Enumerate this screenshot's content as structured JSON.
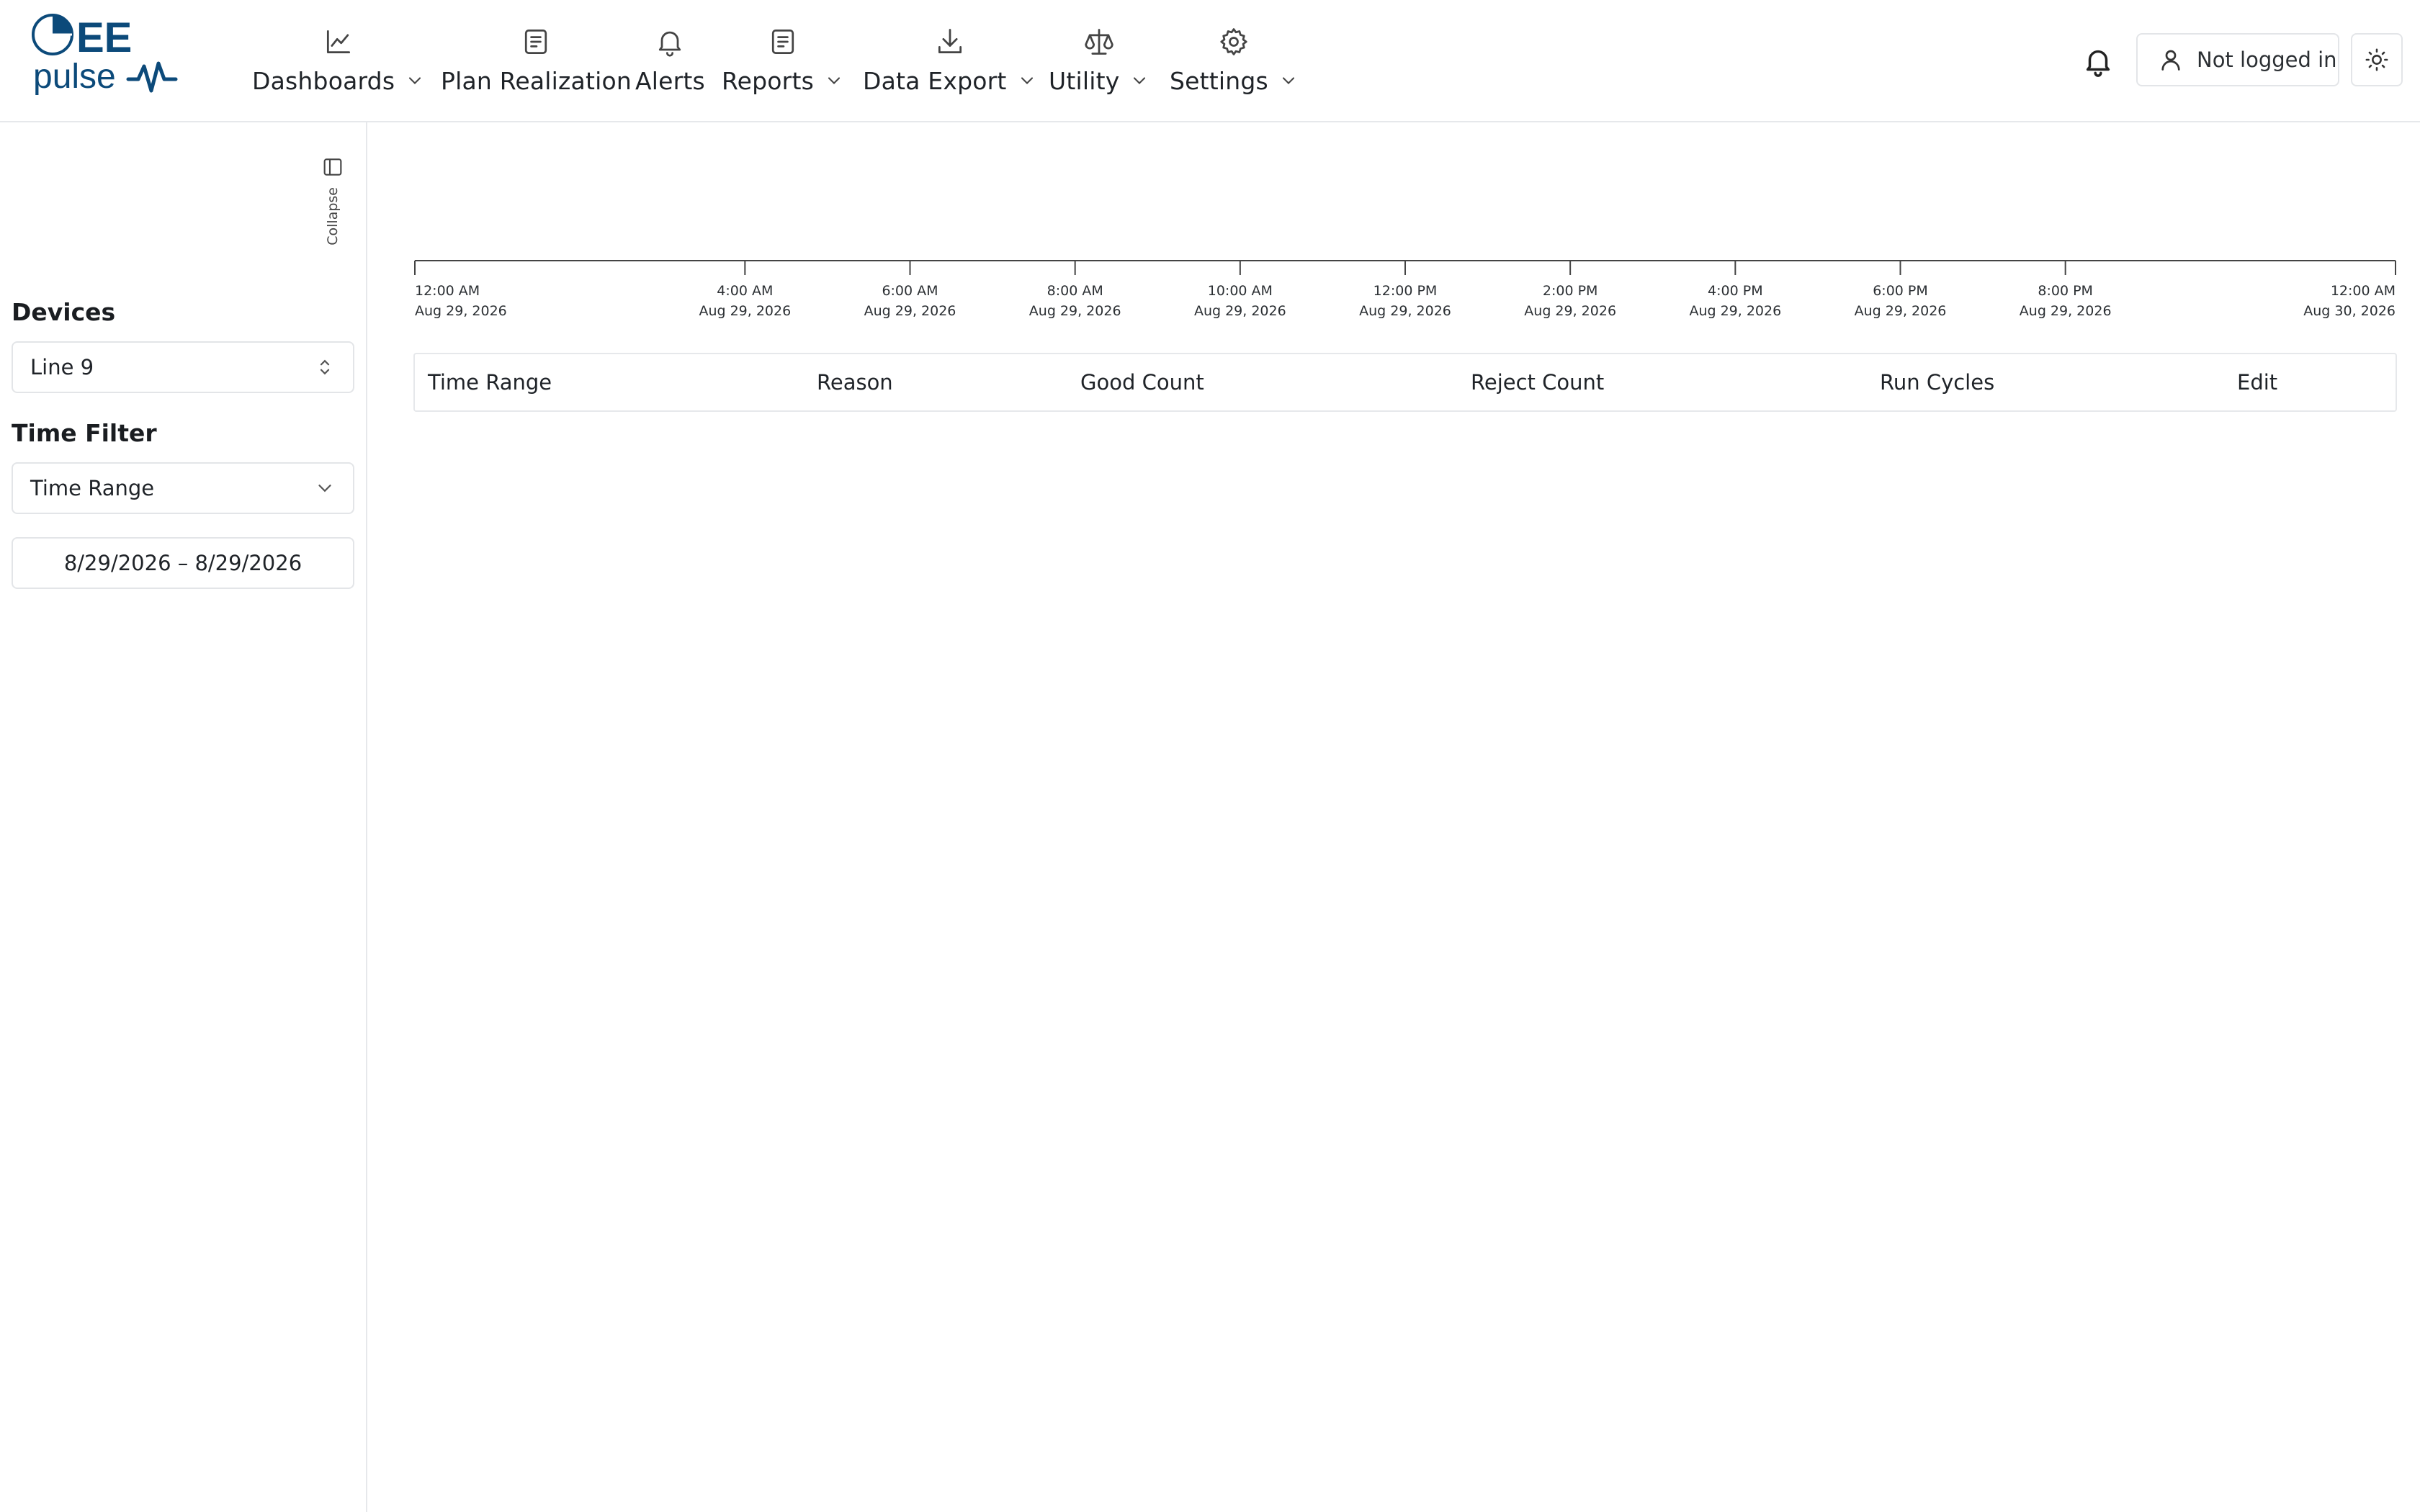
{
  "app": {
    "logo_text_top": "EE",
    "logo_text_bottom": "pulse"
  },
  "nav": {
    "items": [
      {
        "label": "Dashboards",
        "icon": "line-chart-icon",
        "dropdown": true
      },
      {
        "label": "Plan Realization",
        "icon": "document-icon",
        "dropdown": false
      },
      {
        "label": "Alerts",
        "icon": "bell-icon",
        "dropdown": false
      },
      {
        "label": "Reports",
        "icon": "document-icon",
        "dropdown": true
      },
      {
        "label": "Data Export",
        "icon": "download-icon",
        "dropdown": true
      },
      {
        "label": "Utility",
        "icon": "scale-icon",
        "dropdown": true
      },
      {
        "label": "Settings",
        "icon": "gear-icon",
        "dropdown": true
      }
    ],
    "user_label": "Not logged in"
  },
  "sidebar": {
    "collapse_label": "Collapse",
    "devices_heading": "Devices",
    "device_value": "Line 9",
    "time_filter_heading": "Time Filter",
    "time_filter_value": "Time Range",
    "date_range": "8/29/2026 – 8/29/2026"
  },
  "timeline": {
    "ticks": [
      {
        "time": "12:00 AM",
        "date": "Aug 29, 2026"
      },
      {
        "time": "4:00 AM",
        "date": "Aug 29, 2026"
      },
      {
        "time": "6:00 AM",
        "date": "Aug 29, 2026"
      },
      {
        "time": "8:00 AM",
        "date": "Aug 29, 2026"
      },
      {
        "time": "10:00 AM",
        "date": "Aug 29, 2026"
      },
      {
        "time": "12:00 PM",
        "date": "Aug 29, 2026"
      },
      {
        "time": "2:00 PM",
        "date": "Aug 29, 2026"
      },
      {
        "time": "4:00 PM",
        "date": "Aug 29, 2026"
      },
      {
        "time": "6:00 PM",
        "date": "Aug 29, 2026"
      },
      {
        "time": "8:00 PM",
        "date": "Aug 29, 2026"
      },
      {
        "time": "12:00 AM",
        "date": "Aug 30, 2026"
      }
    ]
  },
  "table": {
    "columns": [
      "Time Range",
      "Reason",
      "Good Count",
      "Reject Count",
      "Run Cycles",
      "Edit"
    ]
  },
  "colors": {
    "brand": "#0c4a7a",
    "border": "#e3e5e8",
    "text": "#1f2328"
  }
}
